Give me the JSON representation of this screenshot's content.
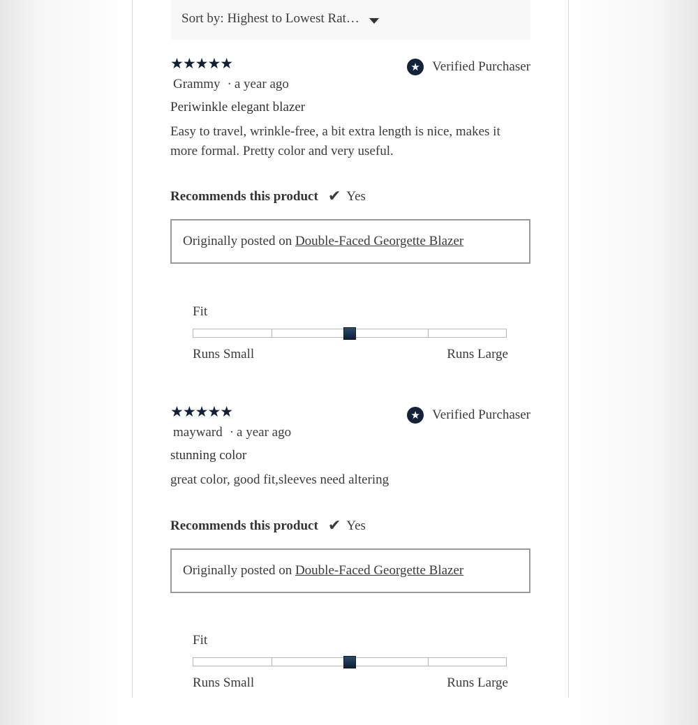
{
  "sort": {
    "label": "Sort by: Highest to Lowest Rat…"
  },
  "reviews": [
    {
      "stars": "★★★★★",
      "rating": 5,
      "verified_icon": "★",
      "verified_label": "Verified Purchaser",
      "author": "Grammy",
      "separator": "·",
      "time": "a year ago",
      "title": "Periwinkle elegant blazer",
      "body": "Easy to travel, wrinkle-free, a bit extra length is nice, makes it more formal. Pretty color and very useful.",
      "recommend_label": "Recommends this product",
      "recommend_icon": "✔",
      "recommend_value": "Yes",
      "origin_prefix": "Originally posted on",
      "origin_link": "Double-Faced Georgette Blazer",
      "fit_label": "Fit",
      "fit_min": "Runs Small",
      "fit_max": "Runs Large",
      "fit_value": 0.5
    },
    {
      "stars": "★★★★★",
      "rating": 5,
      "verified_icon": "★",
      "verified_label": "Verified Purchaser",
      "author": "mayward",
      "separator": "·",
      "time": "a year ago",
      "title": "stunning color",
      "body": "great color, good fit,sleeves need altering",
      "recommend_label": "Recommends this product",
      "recommend_icon": "✔",
      "recommend_value": "Yes",
      "origin_prefix": "Originally posted on",
      "origin_link": "Double-Faced Georgette Blazer",
      "fit_label": "Fit",
      "fit_min": "Runs Small",
      "fit_max": "Runs Large",
      "fit_value": 0.5
    }
  ],
  "colors": {
    "accent_navy": "#0f1f36",
    "text": "#3b3b3b",
    "border": "#9a9a9a"
  }
}
